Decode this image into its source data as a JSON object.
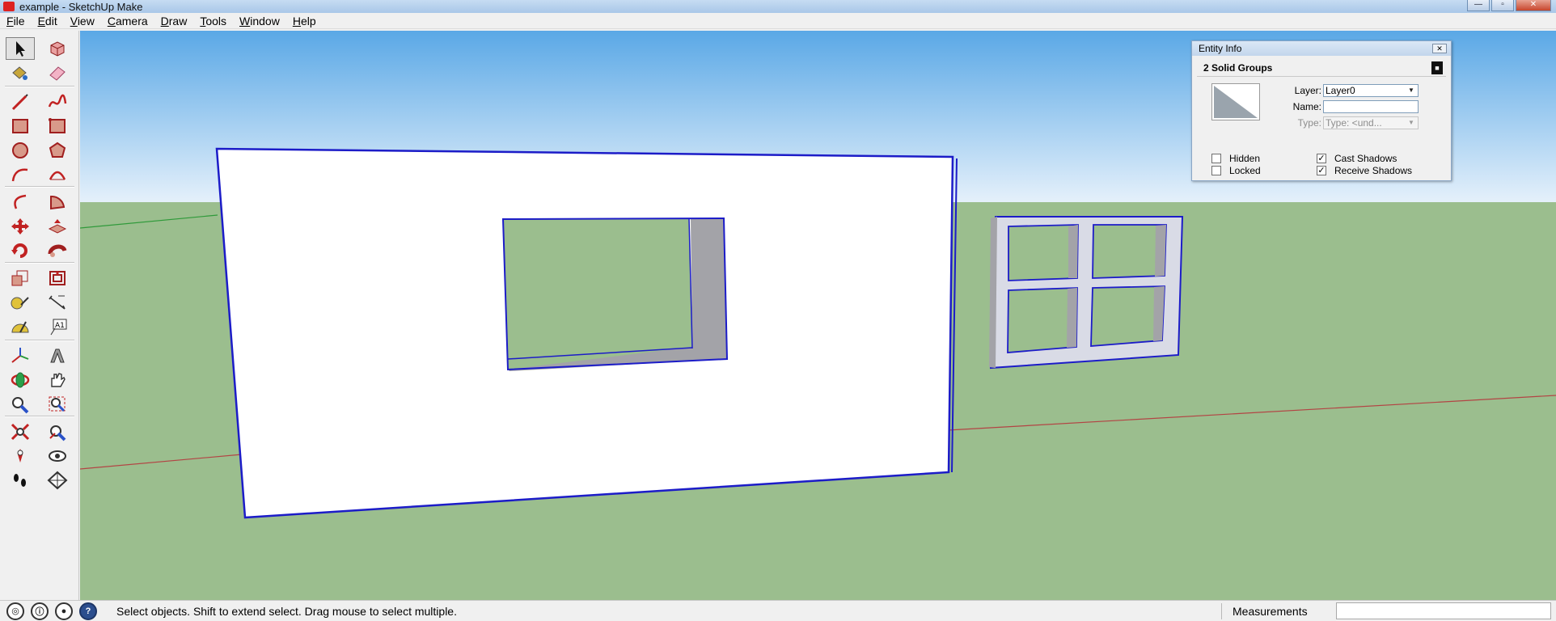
{
  "window": {
    "title": "example - SketchUp Make",
    "controls": {
      "minimize": "—",
      "maximize": "▫",
      "close": "✕"
    }
  },
  "menu": [
    {
      "label": "File",
      "accel": "F",
      "rest": "ile"
    },
    {
      "label": "Edit",
      "accel": "E",
      "rest": "dit"
    },
    {
      "label": "View",
      "accel": "V",
      "rest": "iew"
    },
    {
      "label": "Camera",
      "accel": "C",
      "rest": "amera"
    },
    {
      "label": "Draw",
      "accel": "D",
      "rest": "raw"
    },
    {
      "label": "Tools",
      "accel": "T",
      "rest": "ools"
    },
    {
      "label": "Window",
      "accel": "W",
      "rest": "indow"
    },
    {
      "label": "Help",
      "accel": "H",
      "rest": "elp"
    }
  ],
  "toolbar": {
    "tools": [
      "select-icon",
      "make-component-icon",
      "paint-bucket-icon",
      "eraser-icon",
      "line-icon",
      "freehand-icon",
      "rectangle-icon",
      "rotated-rectangle-icon",
      "circle-icon",
      "polygon-icon",
      "arc-icon",
      "two-point-arc-icon",
      "three-point-arc-icon",
      "pie-icon",
      "move-icon",
      "push-pull-icon",
      "rotate-icon",
      "follow-me-icon",
      "scale-icon",
      "offset-icon",
      "tape-measure-icon",
      "dimensions-icon",
      "protractor-icon",
      "text-icon",
      "axes-icon",
      "3d-text-icon",
      "orbit-icon",
      "pan-icon",
      "zoom-icon",
      "zoom-window-icon",
      "zoom-extents-icon",
      "previous-view-icon",
      "position-camera-icon",
      "look-around-icon",
      "walk-icon",
      "section-plane-icon"
    ],
    "active_tool": "select-icon",
    "dimension_text": "A1"
  },
  "entity_info": {
    "title": "Entity Info",
    "close": "✕",
    "header": "2 Solid Groups",
    "layer_label": "Layer:",
    "layer_value": "Layer0",
    "name_label": "Name:",
    "name_value": "",
    "type_label": "Type:",
    "type_value": "Type: <und...",
    "hidden_label": "Hidden",
    "hidden_checked": false,
    "locked_label": "Locked",
    "locked_checked": false,
    "cast_shadows_label": "Cast Shadows",
    "cast_shadows_checked": true,
    "receive_shadows_label": "Receive Shadows",
    "receive_shadows_checked": true,
    "check_mark": "✓"
  },
  "status": {
    "geo_icon": "geo-location-icon",
    "credits_icon": "credits-icon",
    "account_icon": "account-icon",
    "help_icon": "?",
    "message": "Select objects. Shift to extend select. Drag mouse to select multiple.",
    "measurements_label": "Measurements",
    "measurements_value": ""
  },
  "scene": {
    "sky_top": "#5aa8e6",
    "sky_bottom": "#e6f1fb",
    "ground": "#9bbe8e",
    "selection": "#1c1cc8",
    "wall_face": "#ffffff",
    "reveal_shade": "#a3a3a8"
  }
}
